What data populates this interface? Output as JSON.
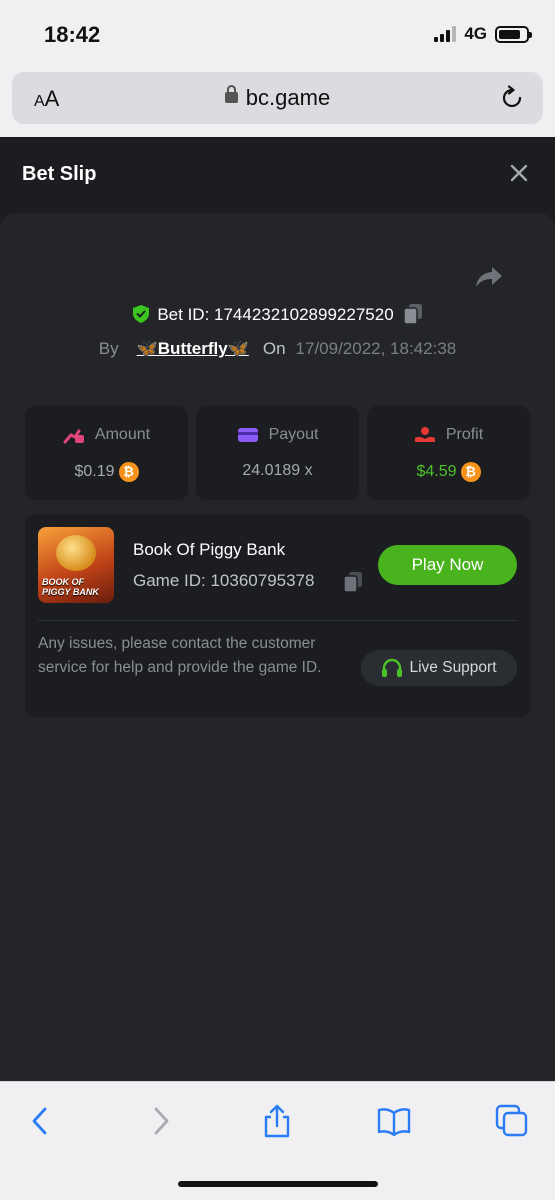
{
  "status_bar": {
    "time": "18:42",
    "network": "4G"
  },
  "browser": {
    "aa": "AA",
    "url": "bc.game"
  },
  "header": {
    "title": "Bet Slip"
  },
  "bet": {
    "id_label": "Bet ID: 1744232102899227520",
    "by_label": "By",
    "user": "🦋Butterfly🦋",
    "on_label": "On",
    "datetime": "17/09/2022, 18:42:38"
  },
  "stats": [
    {
      "label": "Amount",
      "value": "$0.19",
      "icon": "amount-icon",
      "color": "#e0457a"
    },
    {
      "label": "Payout",
      "value": "24.0189 x",
      "icon": "payout-icon",
      "color": "#8b5cf6"
    },
    {
      "label": "Profit",
      "value": "$4.59",
      "icon": "profit-icon",
      "color": "#e53935"
    }
  ],
  "game": {
    "name": "Book Of Piggy Bank",
    "id_label": "Game ID: 10360795378",
    "thumb_text": "BOOK OF PIGGY BANK",
    "play_label": "Play Now"
  },
  "support": {
    "text": "Any issues, please contact the customer service for help and provide the game ID.",
    "button_label": "Live Support"
  },
  "colors": {
    "accent_green": "#49b31d",
    "profit_green": "#4dc12a",
    "btc_orange": "#f7931a"
  }
}
